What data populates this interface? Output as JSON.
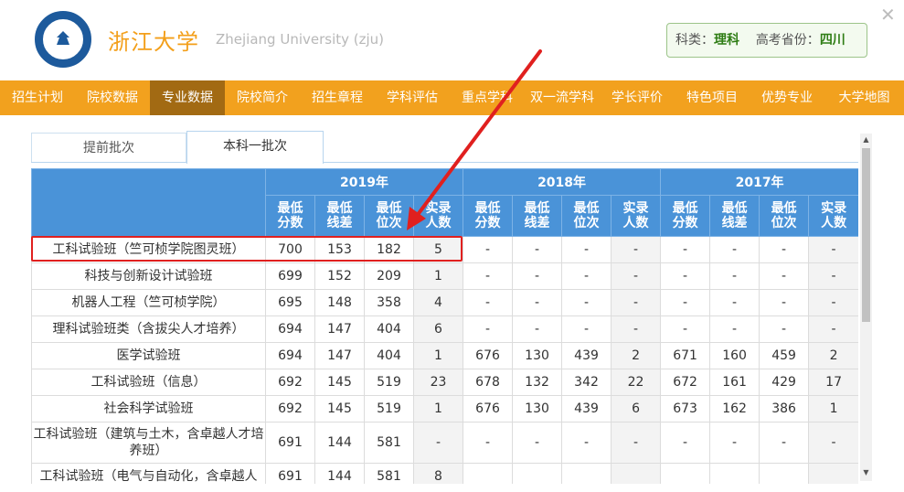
{
  "header": {
    "logo_name": "zju-logo",
    "title_cn": "浙江大学",
    "title_en": "Zhejiang University (zju)",
    "info": {
      "subject_label": "科类：",
      "subject_value": "理科",
      "province_label": "高考省份：",
      "province_value": "四川"
    },
    "close_icon": "close-icon"
  },
  "nav": {
    "items": [
      "招生计划",
      "院校数据",
      "专业数据",
      "院校简介",
      "招生章程",
      "学科评估",
      "重点学科",
      "双一流学科",
      "学长评价",
      "特色项目",
      "优势专业",
      "大学地图"
    ],
    "active_index": 2
  },
  "tabs": {
    "items": [
      "提前批次",
      "本科一批次"
    ],
    "active_index": 1
  },
  "table": {
    "years": [
      "2019年",
      "2018年",
      "2017年"
    ],
    "subcols": [
      [
        "最低",
        "分数"
      ],
      [
        "最低",
        "线差"
      ],
      [
        "最低",
        "位次"
      ],
      [
        "实录",
        "人数"
      ]
    ],
    "rows": [
      {
        "major": "工科试验班（竺可桢学院图灵班）",
        "y2019": [
          "700",
          "153",
          "182",
          "5"
        ],
        "y2018": [
          "-",
          "-",
          "-",
          "-"
        ],
        "y2017": [
          "-",
          "-",
          "-",
          "-"
        ]
      },
      {
        "major": "科技与创新设计试验班",
        "y2019": [
          "699",
          "152",
          "209",
          "1"
        ],
        "y2018": [
          "-",
          "-",
          "-",
          "-"
        ],
        "y2017": [
          "-",
          "-",
          "-",
          "-"
        ]
      },
      {
        "major": "机器人工程（竺可桢学院）",
        "y2019": [
          "695",
          "148",
          "358",
          "4"
        ],
        "y2018": [
          "-",
          "-",
          "-",
          "-"
        ],
        "y2017": [
          "-",
          "-",
          "-",
          "-"
        ]
      },
      {
        "major": "理科试验班类（含拔尖人才培养）",
        "y2019": [
          "694",
          "147",
          "404",
          "6"
        ],
        "y2018": [
          "-",
          "-",
          "-",
          "-"
        ],
        "y2017": [
          "-",
          "-",
          "-",
          "-"
        ]
      },
      {
        "major": "医学试验班",
        "y2019": [
          "694",
          "147",
          "404",
          "1"
        ],
        "y2018": [
          "676",
          "130",
          "439",
          "2"
        ],
        "y2017": [
          "671",
          "160",
          "459",
          "2"
        ]
      },
      {
        "major": "工科试验班（信息）",
        "y2019": [
          "692",
          "145",
          "519",
          "23"
        ],
        "y2018": [
          "678",
          "132",
          "342",
          "22"
        ],
        "y2017": [
          "672",
          "161",
          "429",
          "17"
        ]
      },
      {
        "major": "社会科学试验班",
        "y2019": [
          "692",
          "145",
          "519",
          "1"
        ],
        "y2018": [
          "676",
          "130",
          "439",
          "6"
        ],
        "y2017": [
          "673",
          "162",
          "386",
          "1"
        ]
      },
      {
        "major": "工科试验班（建筑与土木，含卓越人才培养班）",
        "y2019": [
          "691",
          "144",
          "581",
          "-"
        ],
        "y2018": [
          "-",
          "-",
          "-",
          "-"
        ],
        "y2017": [
          "-",
          "-",
          "-",
          "-"
        ]
      },
      {
        "major": "工科试验班（电气与自动化，含卓越人",
        "y2019": [
          "691",
          "144",
          "581",
          "8"
        ],
        "y2018": [
          "",
          "",
          "",
          ""
        ],
        "y2017": [
          "",
          "",
          "",
          ""
        ]
      }
    ]
  },
  "colors": {
    "nav_bg": "#f2a11e",
    "nav_active": "#a26a13",
    "header_blue": "#4a93d8",
    "title_orange": "#f39f1a",
    "info_green": "#2f7d15",
    "highlight_red": "#e0201f"
  }
}
